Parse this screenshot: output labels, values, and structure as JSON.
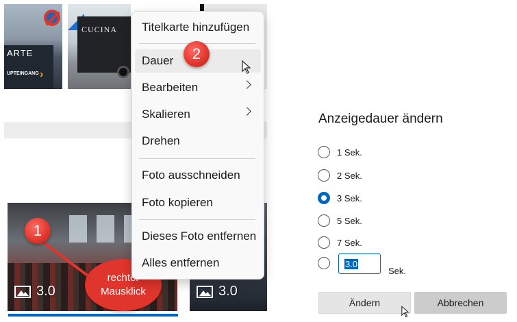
{
  "storyboard": {
    "top_thumbs": [
      {
        "sign_title": "ARTE",
        "sign_sub": "UPTEINGANG"
      },
      {
        "trailer_text": "CUCINA"
      }
    ],
    "bottom_thumbs": [
      {
        "duration": "3.0"
      },
      {
        "duration": "3.0"
      }
    ]
  },
  "annotations": {
    "badge1": "1",
    "badge2": "2",
    "callout_line1": "rechter",
    "callout_line2": "Mausklick"
  },
  "context_menu": {
    "items": [
      {
        "label": "Titelkarte hinzufügen"
      },
      {
        "label": "Dauer"
      },
      {
        "label": "Bearbeiten"
      },
      {
        "label": "Skalieren"
      },
      {
        "label": "Drehen"
      },
      {
        "label": "Foto ausschneiden"
      },
      {
        "label": "Foto kopieren"
      },
      {
        "label": "Dieses Foto entfernen"
      },
      {
        "label": "Alles entfernen"
      }
    ]
  },
  "dialog": {
    "title": "Anzeigedauer ändern",
    "options": [
      {
        "label": "1 Sek.",
        "checked": false
      },
      {
        "label": "2 Sek.",
        "checked": false
      },
      {
        "label": "3 Sek.",
        "checked": true
      },
      {
        "label": "5 Sek.",
        "checked": false
      },
      {
        "label": "7 Sek.",
        "checked": false
      }
    ],
    "custom_value": "3.0",
    "custom_unit": "Sek.",
    "ok_label": "Ändern",
    "cancel_label": "Abbrechen"
  },
  "colors": {
    "accent": "#0067c0",
    "annotation_red": "#e0352c"
  }
}
